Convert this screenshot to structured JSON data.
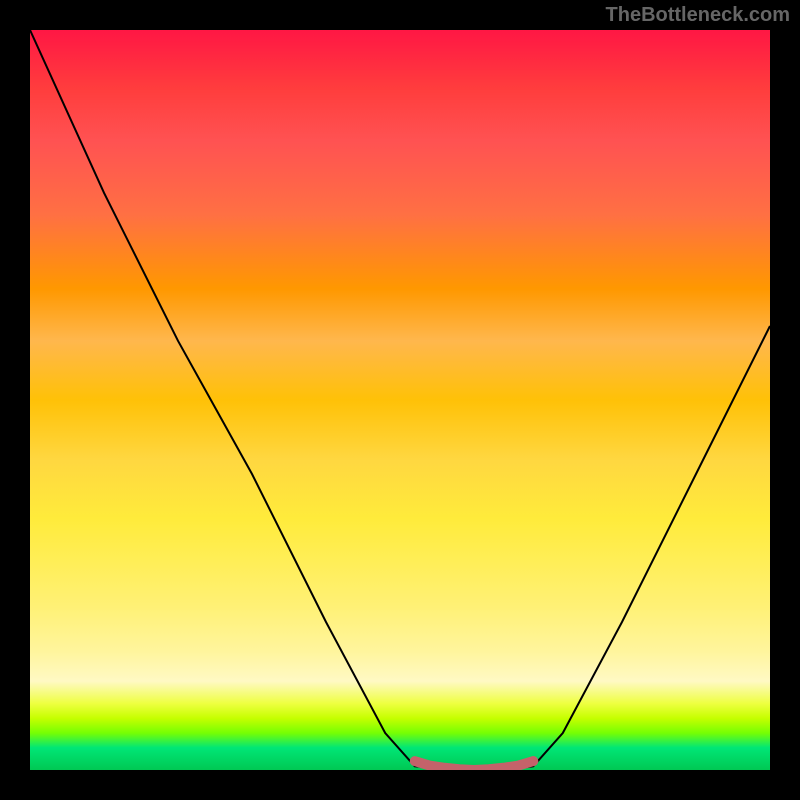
{
  "watermark": "TheBottleneck.com",
  "chart_data": {
    "type": "line",
    "title": "",
    "xlabel": "",
    "ylabel": "",
    "series": [
      {
        "name": "curve",
        "color": "#000000",
        "points": [
          {
            "x": 0,
            "y": 100
          },
          {
            "x": 10,
            "y": 78
          },
          {
            "x": 20,
            "y": 58
          },
          {
            "x": 30,
            "y": 40
          },
          {
            "x": 40,
            "y": 20
          },
          {
            "x": 48,
            "y": 5
          },
          {
            "x": 52,
            "y": 0.5
          },
          {
            "x": 58,
            "y": 0
          },
          {
            "x": 64,
            "y": 0
          },
          {
            "x": 68,
            "y": 0.5
          },
          {
            "x": 72,
            "y": 5
          },
          {
            "x": 80,
            "y": 20
          },
          {
            "x": 90,
            "y": 40
          },
          {
            "x": 100,
            "y": 60
          }
        ]
      },
      {
        "name": "bottom-marker",
        "color": "#c4626a",
        "points": [
          {
            "x": 52,
            "y": 1.2
          },
          {
            "x": 54,
            "y": 0.6
          },
          {
            "x": 56,
            "y": 0.3
          },
          {
            "x": 58,
            "y": 0.1
          },
          {
            "x": 60,
            "y": 0.0
          },
          {
            "x": 62,
            "y": 0.1
          },
          {
            "x": 64,
            "y": 0.3
          },
          {
            "x": 66,
            "y": 0.6
          },
          {
            "x": 68,
            "y": 1.2
          }
        ]
      }
    ],
    "xlim": [
      0,
      100
    ],
    "ylim": [
      0,
      100
    ],
    "gradient_stops": [
      {
        "pos": 0,
        "color": "#ff1744"
      },
      {
        "pos": 50,
        "color": "#ffc107"
      },
      {
        "pos": 90,
        "color": "#eeff41"
      },
      {
        "pos": 100,
        "color": "#00c853"
      }
    ]
  }
}
